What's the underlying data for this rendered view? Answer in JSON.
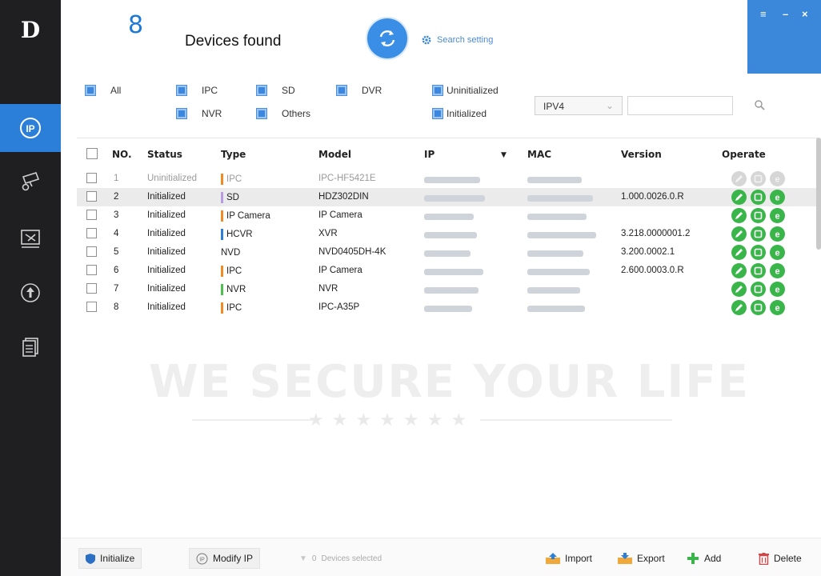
{
  "rail": {
    "logo": "D",
    "items": [
      {
        "name": "ip-icon",
        "active": true
      },
      {
        "name": "camera-settings-icon",
        "active": false
      },
      {
        "name": "tools-icon",
        "active": false
      },
      {
        "name": "upgrade-icon",
        "active": false
      },
      {
        "name": "documents-icon",
        "active": false
      }
    ]
  },
  "header": {
    "count": "8",
    "title": "Devices found",
    "search_setting": "Search setting",
    "window": {
      "menu": "≡",
      "minimize": "–",
      "close": "×"
    }
  },
  "filters": {
    "all": "All",
    "ipc": "IPC",
    "sd": "SD",
    "dvr": "DVR",
    "nvr": "NVR",
    "others": "Others",
    "uninitialized": "Uninitialized",
    "initialized": "Initialized",
    "ip_version": "IPV4",
    "search_value": ""
  },
  "table": {
    "columns": {
      "no": "NO.",
      "status": "Status",
      "type": "Type",
      "model": "Model",
      "ip": "IP",
      "mac": "MAC",
      "version": "Version",
      "operate": "Operate"
    },
    "rows": [
      {
        "no": "1",
        "status": "Uninitialized",
        "type": "IPC",
        "type_color": "#f08a24",
        "model": "IPC-HF5421E",
        "version": "",
        "dim": true
      },
      {
        "no": "2",
        "status": "Initialized",
        "type": "SD",
        "type_color": "#b89be0",
        "model": "HDZ302DIN",
        "version": "1.000.0026.0.R",
        "dim": false
      },
      {
        "no": "3",
        "status": "Initialized",
        "type": "IP Camera",
        "type_color": "#f08a24",
        "model": "IP Camera",
        "version": "",
        "dim": false
      },
      {
        "no": "4",
        "status": "Initialized",
        "type": "HCVR",
        "type_color": "#2e7fd8",
        "model": "XVR",
        "version": "3.218.0000001.2",
        "dim": false
      },
      {
        "no": "5",
        "status": "Initialized",
        "type": "NVD",
        "type_color": "",
        "model": "NVD0405DH-4K",
        "version": "3.200.0002.1",
        "dim": false
      },
      {
        "no": "6",
        "status": "Initialized",
        "type": "IPC",
        "type_color": "#f08a24",
        "model": "IP Camera",
        "version": "2.600.0003.0.R",
        "dim": false
      },
      {
        "no": "7",
        "status": "Initialized",
        "type": "NVR",
        "type_color": "#4cc04c",
        "model": "NVR",
        "version": "",
        "dim": false
      },
      {
        "no": "8",
        "status": "Initialized",
        "type": "IPC",
        "type_color": "#f08a24",
        "model": "IPC-A35P",
        "version": "",
        "dim": false
      }
    ]
  },
  "watermark": {
    "text": "WE SECURE YOUR LIFE",
    "stars": "★★★★★★★"
  },
  "bottom": {
    "initialize": "Initialize",
    "modify_ip": "Modify IP",
    "selected_count": "0",
    "selected_text": "Devices selected",
    "import": "Import",
    "export": "Export",
    "add": "Add",
    "delete": "Delete"
  },
  "colors": {
    "accent": "#2b7fd9",
    "rail_bg": "#1f1f22",
    "operate_green": "#3ab54a"
  }
}
